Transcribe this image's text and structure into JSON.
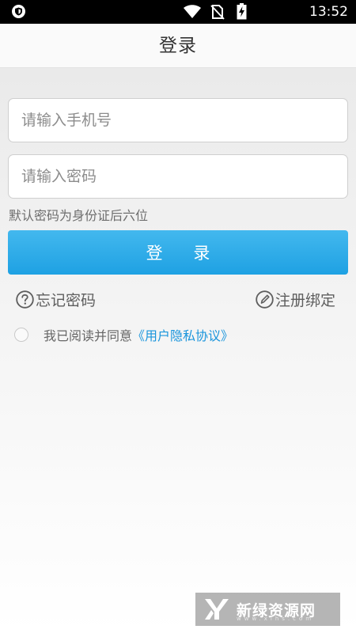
{
  "status_bar": {
    "time": "13:52",
    "icons": [
      "shield-icon",
      "wifi-icon",
      "no-sim-icon",
      "battery-charging-icon"
    ]
  },
  "header": {
    "title": "登录"
  },
  "form": {
    "phone_placeholder": "请输入手机号",
    "password_placeholder": "请输入密码",
    "hint": "默认密码为身份证后六位",
    "login_label": "登 录"
  },
  "links": {
    "forgot_password": "忘记密码",
    "register_bind": "注册绑定"
  },
  "agreement": {
    "text": "我已阅读并同意",
    "policy_link": "《用户隐私协议》"
  },
  "watermark": {
    "text": "新绿资源网",
    "sub": "www.xlhs.com"
  },
  "colors": {
    "accent": "#1ea1e3",
    "link": "#1a95dc"
  }
}
